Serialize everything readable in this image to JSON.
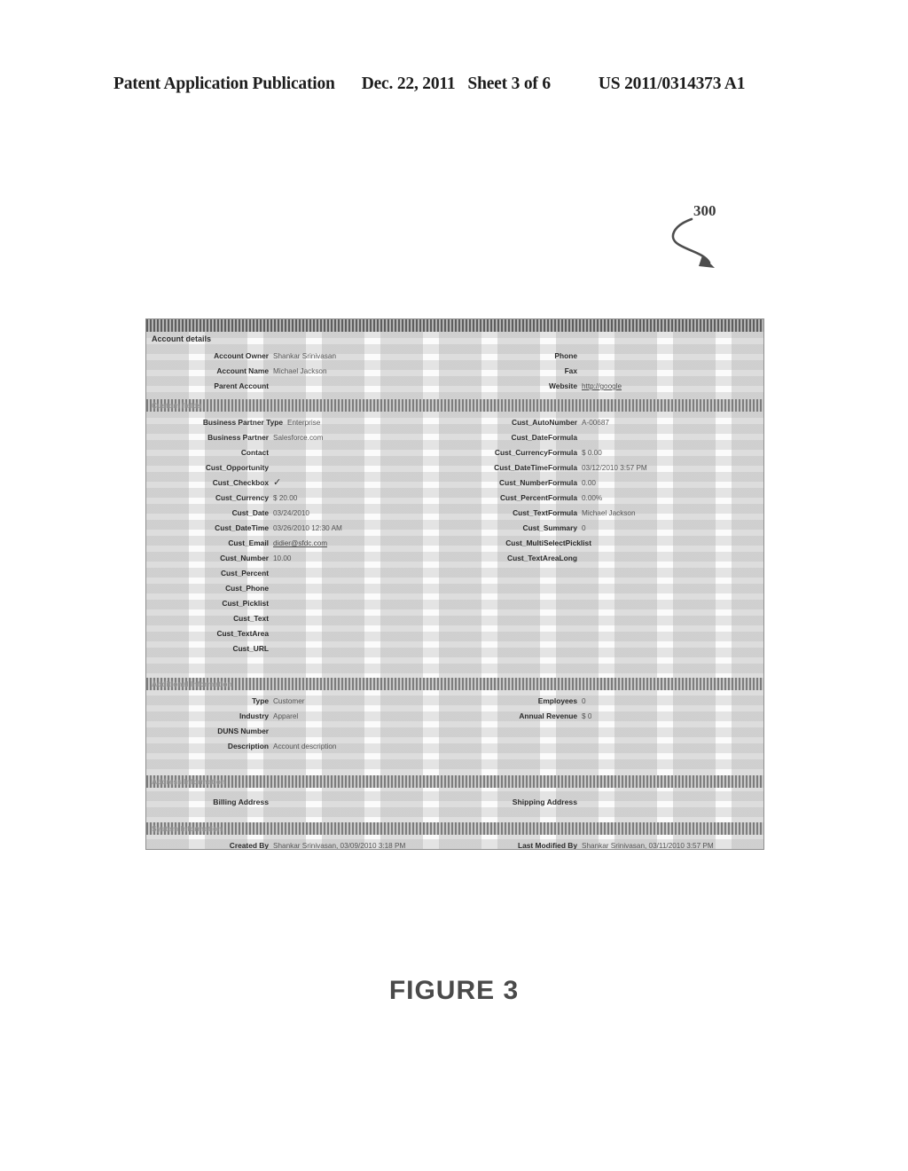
{
  "patent_header": {
    "publication": "Patent Application Publication",
    "date": "Dec. 22, 2011",
    "sheet": "Sheet 3 of 6",
    "number": "US 2011/0314373 A1"
  },
  "callout": {
    "reference_numeral": "300"
  },
  "figure_caption": "FIGURE 3",
  "screenshot": {
    "sections": [
      {
        "id": "account-details",
        "title": "Account details",
        "title_placement": "below",
        "band_style": "dark",
        "left_fields": [
          {
            "label": "Account Owner",
            "value": "Shankar Srinivasan",
            "type": "text"
          },
          {
            "label": "Account Name",
            "value": "Michael Jackson",
            "type": "text"
          },
          {
            "label": "Parent Account",
            "value": "",
            "type": "text"
          }
        ],
        "right_fields": [
          {
            "label": "Phone",
            "value": "",
            "type": "text"
          },
          {
            "label": "Fax",
            "value": "",
            "type": "text"
          },
          {
            "label": "Website",
            "value": "http://google",
            "type": "link"
          }
        ]
      },
      {
        "id": "custom-fields",
        "title": "Custom fields",
        "title_placement": "inband",
        "band_style": "faded",
        "left_fields": [
          {
            "label": "Business Partner Type",
            "value": "Enterprise",
            "type": "text"
          },
          {
            "label": "Business Partner",
            "value": "Salesforce.com",
            "type": "text"
          },
          {
            "label": "Contact",
            "value": "",
            "type": "text"
          },
          {
            "label": "Cust_Opportunity",
            "value": "",
            "type": "text"
          },
          {
            "label": "Cust_Checkbox",
            "value": "✓",
            "type": "check"
          },
          {
            "label": "Cust_Currency",
            "value": "$ 20.00",
            "type": "text"
          },
          {
            "label": "Cust_Date",
            "value": "03/24/2010",
            "type": "text"
          },
          {
            "label": "Cust_DateTime",
            "value": "03/26/2010 12:30 AM",
            "type": "text"
          },
          {
            "label": "Cust_Email",
            "value": "didier@sfdc.com",
            "type": "link"
          },
          {
            "label": "Cust_Number",
            "value": "10.00",
            "type": "text"
          },
          {
            "label": "Cust_Percent",
            "value": "",
            "type": "text"
          },
          {
            "label": "Cust_Phone",
            "value": "",
            "type": "text"
          },
          {
            "label": "Cust_Picklist",
            "value": "",
            "type": "text"
          },
          {
            "label": "Cust_Text",
            "value": "",
            "type": "text"
          },
          {
            "label": "Cust_TextArea",
            "value": "",
            "type": "text"
          },
          {
            "label": "Cust_URL",
            "value": "",
            "type": "text"
          }
        ],
        "right_fields": [
          {
            "label": "Cust_AutoNumber",
            "value": "A-00687",
            "type": "text"
          },
          {
            "label": "Cust_DateFormula",
            "value": "",
            "type": "text"
          },
          {
            "label": "Cust_CurrencyFormula",
            "value": "$ 0.00",
            "type": "text"
          },
          {
            "label": "Cust_DateTimeFormula",
            "value": "03/12/2010 3:57 PM",
            "type": "text"
          },
          {
            "label": "Cust_NumberFormula",
            "value": "0.00",
            "type": "text"
          },
          {
            "label": "Cust_PercentFormula",
            "value": "0.00%",
            "type": "text"
          },
          {
            "label": "Cust_TextFormula",
            "value": "Michael Jackson",
            "type": "text"
          },
          {
            "label": "Cust_Summary",
            "value": "0",
            "type": "text"
          },
          {
            "label": "Cust_MultiSelectPicklist",
            "value": "",
            "type": "text"
          },
          {
            "label": "Cust_TextAreaLong",
            "value": "",
            "type": "text"
          }
        ]
      },
      {
        "id": "additional-information",
        "title": "Additional Information",
        "title_placement": "inband",
        "band_style": "faded",
        "left_fields": [
          {
            "label": "Type",
            "value": "Customer",
            "type": "text"
          },
          {
            "label": "Industry",
            "value": "Apparel",
            "type": "text"
          },
          {
            "label": "DUNS Number",
            "value": "",
            "type": "text"
          },
          {
            "label": "Description",
            "value": "Account description",
            "type": "text"
          }
        ],
        "right_fields": [
          {
            "label": "Employees",
            "value": "0",
            "type": "text"
          },
          {
            "label": "Annual Revenue",
            "value": "$ 0",
            "type": "text"
          }
        ]
      },
      {
        "id": "address-information",
        "title": "Address Information",
        "title_placement": "inband",
        "band_style": "faded",
        "left_fields": [
          {
            "label": "Billing Address",
            "value": "",
            "type": "text"
          }
        ],
        "right_fields": [
          {
            "label": "Shipping Address",
            "value": "",
            "type": "text"
          }
        ]
      },
      {
        "id": "system-information",
        "title": "System Information",
        "title_placement": "inband",
        "band_style": "faded",
        "left_fields": [
          {
            "label": "Created By",
            "value": "Shankar Srinivasan, 03/09/2010 3:18 PM",
            "type": "text"
          }
        ],
        "right_fields": [
          {
            "label": "Last Modified By",
            "value": "Shankar Srinivasan, 03/11/2010 3:57 PM",
            "type": "text"
          }
        ]
      }
    ]
  }
}
